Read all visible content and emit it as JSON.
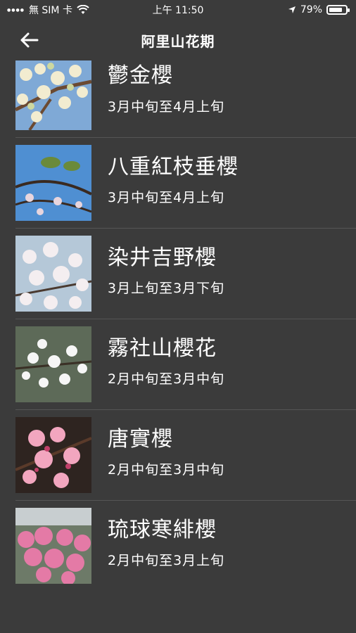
{
  "status": {
    "carrier": "無 SIM 卡",
    "time": "上午 11:50",
    "battery": "79%",
    "battery_level": 0.79
  },
  "nav": {
    "title": "阿里山花期",
    "back_icon": "arrow-left-icon"
  },
  "items": [
    {
      "name": "鬱金櫻",
      "period": "3月中旬至4月上旬"
    },
    {
      "name": "八重紅枝垂櫻",
      "period": "3月中旬至4月上旬"
    },
    {
      "name": "染井吉野櫻",
      "period": "3月上旬至3月下旬"
    },
    {
      "name": "霧社山櫻花",
      "period": "2月中旬至3月中旬"
    },
    {
      "name": "唐實櫻",
      "period": "2月中旬至3月中旬"
    },
    {
      "name": "琉球寒緋櫻",
      "period": "2月中旬至3月上旬"
    }
  ],
  "colors": {
    "background": "#3b3b3b",
    "text": "#ffffff",
    "divider": "#555555"
  }
}
